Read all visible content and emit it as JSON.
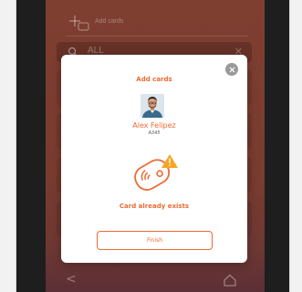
{
  "background_screen": {
    "add_cards_label": "Add cards",
    "search_value": "ALL",
    "clear_glyph": "✕",
    "back_glyph": "<"
  },
  "modal": {
    "title": "Add cards",
    "user": {
      "name": "Alex Felipez",
      "id": "A345"
    },
    "status": "Card already exists",
    "finish_label": "Finish"
  },
  "colors": {
    "accent": "#ee6a33",
    "warning": "#f5a623",
    "overlay": "#7e3f31"
  },
  "icons": {
    "close": "close-icon",
    "card_warning": "nfc-card-warning-icon",
    "add_cards": "add-card-icon",
    "search": "search-icon",
    "home": "home-icon",
    "back": "back-icon"
  }
}
